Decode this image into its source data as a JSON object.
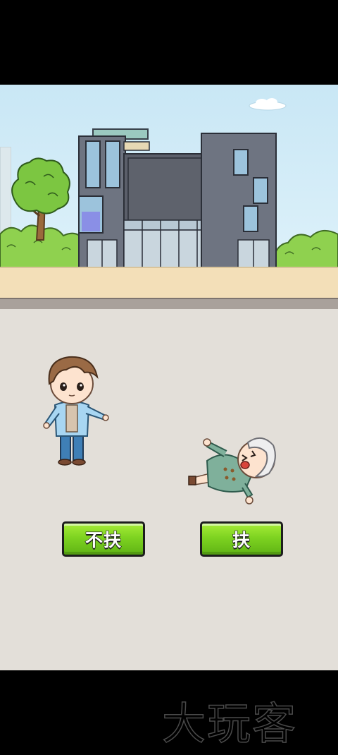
{
  "choices": {
    "dont_help_label": "不扶",
    "help_label": "扶"
  },
  "watermark": "大玩客",
  "colors": {
    "button_green": "#7ed321",
    "road": "#e3dfd9",
    "sky": "#c9e7f5"
  }
}
